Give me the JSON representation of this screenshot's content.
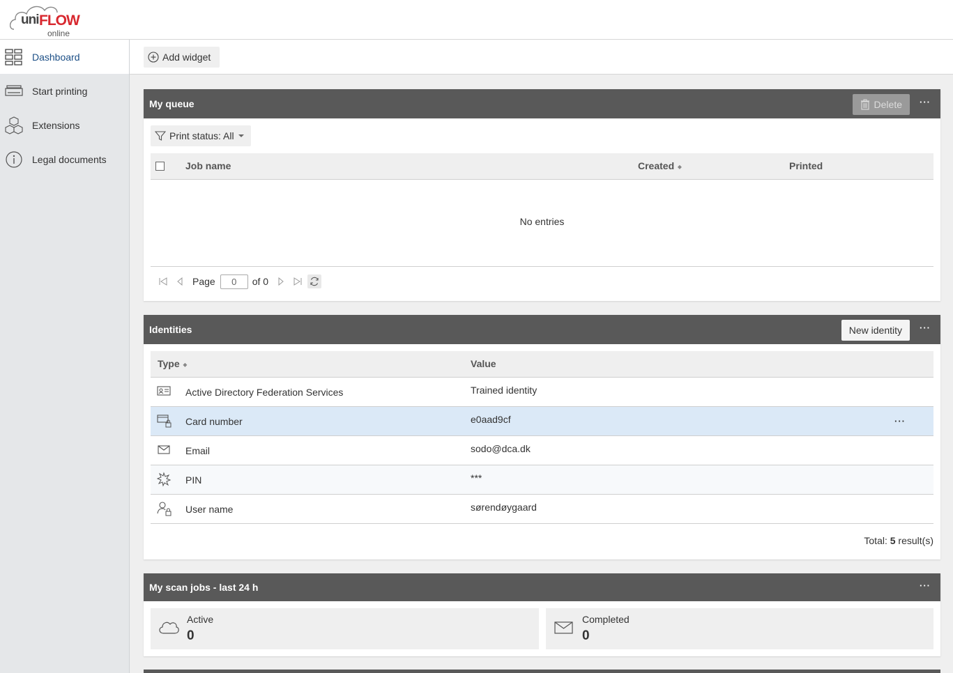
{
  "header": {
    "logo_uni": "uni",
    "logo_flow": "FLOW",
    "logo_online": "online"
  },
  "sidebar": {
    "items": [
      {
        "label": "Dashboard",
        "icon": "dashboard-grid-icon",
        "active": true
      },
      {
        "label": "Start printing",
        "icon": "printer-tray-icon"
      },
      {
        "label": "Extensions",
        "icon": "cubes-icon"
      },
      {
        "label": "Legal documents",
        "icon": "info-circle-icon"
      }
    ]
  },
  "toolbar": {
    "add_widget_label": "Add widget"
  },
  "queue": {
    "title": "My queue",
    "delete_label": "Delete",
    "more_label": "···",
    "filter_label": "Print status: All",
    "columns": [
      "Job name",
      "Created",
      "Printed"
    ],
    "empty_text": "No entries",
    "pager": {
      "page_label": "Page",
      "page_value": "0",
      "of_label": "of 0"
    }
  },
  "identities": {
    "title": "Identities",
    "new_label": "New identity",
    "more_label": "···",
    "columns": [
      "Type",
      "Value"
    ],
    "rows": [
      {
        "type": "Active Directory Federation Services",
        "value": "Trained identity",
        "icon": "id-card-icon"
      },
      {
        "type": "Card number",
        "value": "e0aad9cf",
        "icon": "card-lock-icon",
        "selected": true,
        "row_more": "···"
      },
      {
        "type": "Email",
        "value": "sodo@dca.dk",
        "icon": "envelope-icon"
      },
      {
        "type": "PIN",
        "value": "***",
        "icon": "pin-asterisk-icon"
      },
      {
        "type": "User name",
        "value": "sørendøygaard",
        "icon": "user-lock-icon"
      }
    ],
    "total_prefix": "Total: ",
    "total_count": "5",
    "total_suffix": " result(s)"
  },
  "scan": {
    "title": "My scan jobs - last 24 h",
    "more_label": "···",
    "cards": [
      {
        "label": "Active",
        "value": "0",
        "icon": "cloud-icon"
      },
      {
        "label": "Completed",
        "value": "0",
        "icon": "envelope-icon"
      }
    ]
  },
  "colors": {
    "header_bar": "#595959",
    "active_nav_text": "#1c4f86",
    "selected_row": "#dbe9f7",
    "brand_red": "#d8282f"
  }
}
